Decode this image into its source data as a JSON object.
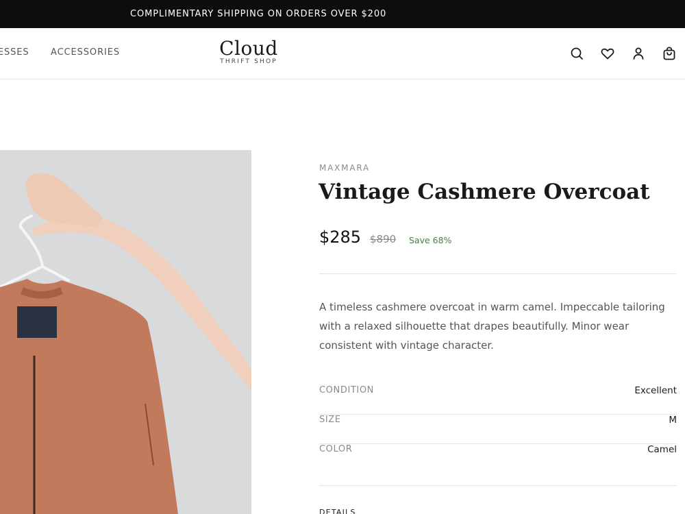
{
  "promo": {
    "text": "COMPLIMENTARY SHIPPING ON ORDERS OVER $200"
  },
  "nav": {
    "items": [
      {
        "label": "DRESSES"
      },
      {
        "label": "ACCESSORIES"
      }
    ]
  },
  "logo": {
    "main": "Cloud",
    "sub": "THRIFT SHOP"
  },
  "header_icons": [
    "search-icon",
    "heart-icon",
    "account-icon",
    "shopping-bag-icon"
  ],
  "product": {
    "brand": "MAXMARA",
    "title": "Vintage Cashmere Overcoat",
    "price": "$285",
    "original_price": "$890",
    "savings": "Save 68%",
    "description": "A timeless cashmere overcoat in warm camel. Impeccable tailoring with a relaxed silhouette that drapes beautifully. Minor wear consistent with vintage character.",
    "specs": [
      {
        "label": "CONDITION",
        "value": "Excellent"
      },
      {
        "label": "SIZE",
        "value": "M"
      },
      {
        "label": "COLOR",
        "value": "Camel"
      }
    ],
    "details_label": "DETAILS"
  },
  "colors": {
    "promo_bg": "#0d0d0d",
    "savings_green": "#4a7d4a",
    "jacket": "#c27a5c",
    "image_bg": "#d9dadc"
  }
}
